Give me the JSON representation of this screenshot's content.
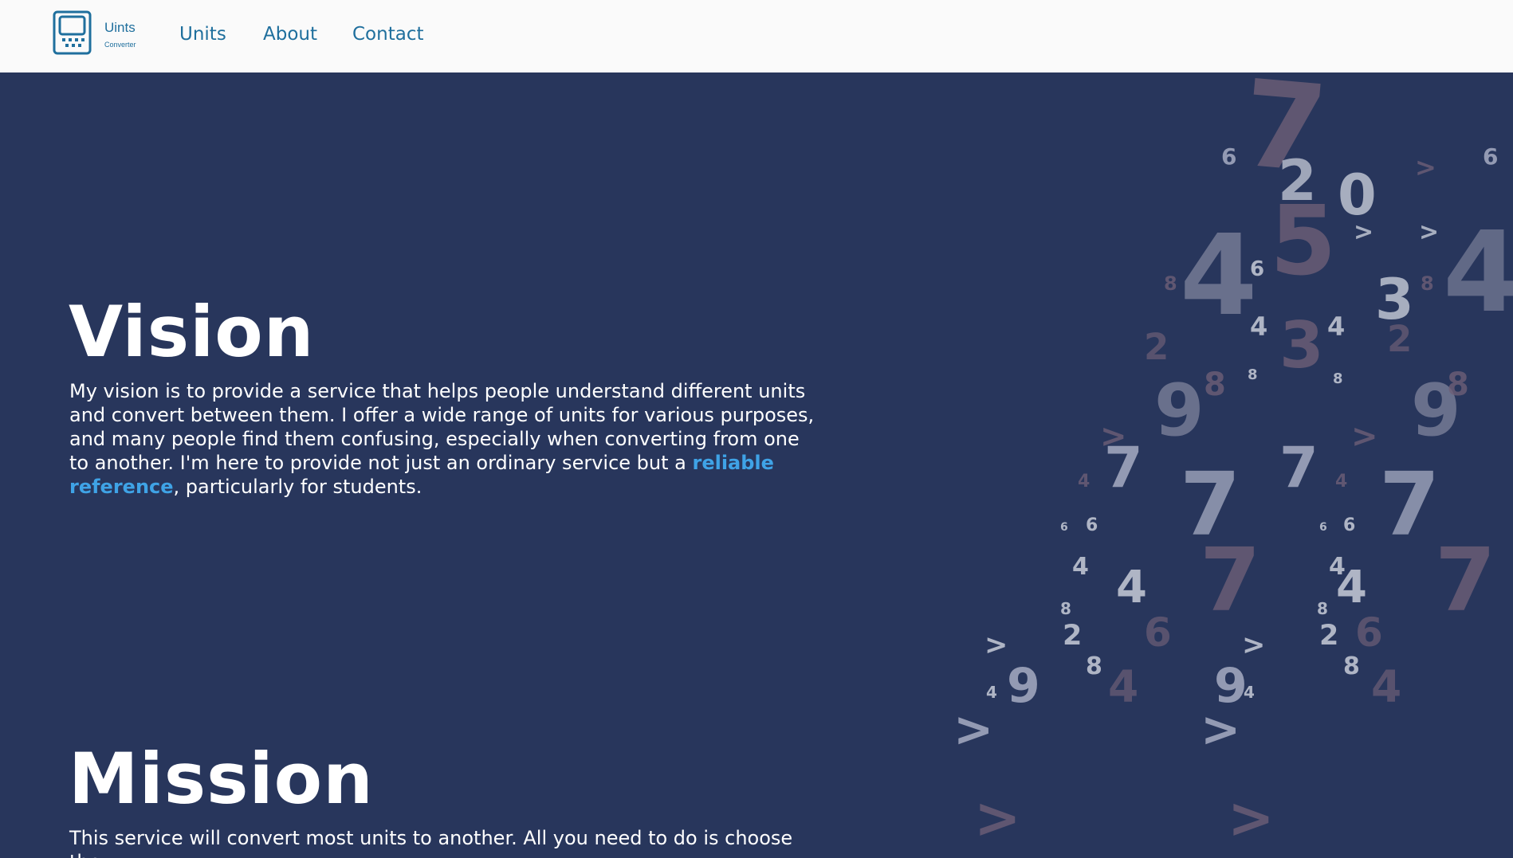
{
  "navbar": {
    "logo_title": "Uints",
    "logo_subtitle": "Converter",
    "links": [
      "Units",
      "About",
      "Contact"
    ],
    "brand_color": "#1f6f9d"
  },
  "vision": {
    "heading": "Vision",
    "text_before": "My vision is to provide a service that helps people understand different units and convert between them. I offer a wide range of units for various purposes, and many people find them confusing, especially when converting from one to another. I'm here to provide not just an ordinary service but a ",
    "highlight": "reliable reference",
    "text_after": ", particularly for students."
  },
  "mission": {
    "heading": "Mission",
    "text_visible": "This service will convert most units to another. All you need to do is choose the"
  },
  "colors": {
    "background": "#28365c",
    "navbar_bg": "#fafafa",
    "highlight": "#3fa3e6",
    "text": "#ffffff"
  },
  "decor": {
    "icon": "falling-digits-decoration"
  }
}
